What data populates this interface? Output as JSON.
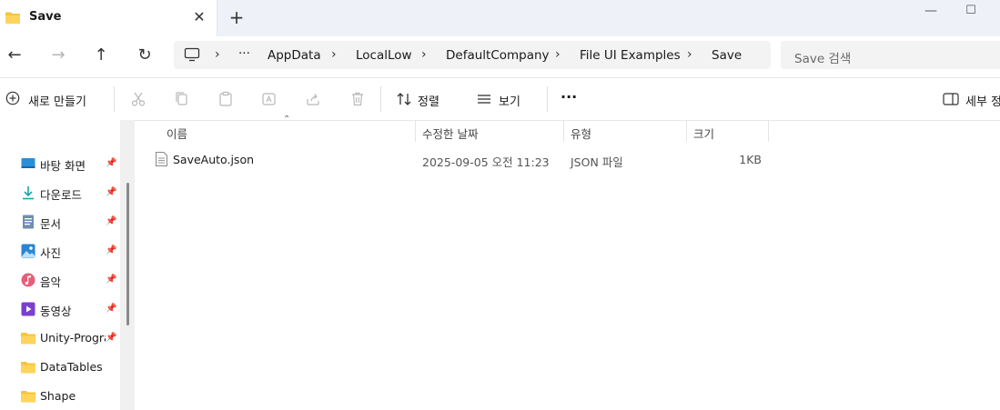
{
  "tab": {
    "title": "Save",
    "close": "✕"
  },
  "window": {
    "newtab": "+",
    "minimize": "—",
    "maximize": "☐"
  },
  "nav": {
    "back": "←",
    "forward": "→",
    "up": "↑",
    "refresh": "↻"
  },
  "address": {
    "ellipsis": "···",
    "sep": "›",
    "crumbs": [
      "AppData",
      "LocalLow",
      "DefaultCompany",
      "File UI Examples",
      "Save"
    ]
  },
  "search": {
    "placeholder": "Save 검색"
  },
  "commands": {
    "new": "새로 만들기",
    "sort": "정렬",
    "view": "보기",
    "more": "···",
    "details": "세부 정"
  },
  "sidebar": {
    "items": [
      {
        "label": "바탕 화면",
        "icon": "desktop-icon",
        "pinned": true
      },
      {
        "label": "다운로드",
        "icon": "download-icon",
        "pinned": true
      },
      {
        "label": "문서",
        "icon": "document-icon",
        "pinned": true
      },
      {
        "label": "사진",
        "icon": "pictures-icon",
        "pinned": true
      },
      {
        "label": "음악",
        "icon": "music-icon",
        "pinned": true
      },
      {
        "label": "동영상",
        "icon": "video-icon",
        "pinned": true
      },
      {
        "label": "Unity-Program",
        "icon": "folder-icon",
        "pinned": true
      },
      {
        "label": "DataTables",
        "icon": "folder-icon",
        "pinned": false
      },
      {
        "label": "Shape",
        "icon": "folder-icon",
        "pinned": false
      }
    ]
  },
  "columns": {
    "name": "이름",
    "modified": "수정한 날짜",
    "type": "유형",
    "size": "크기"
  },
  "files": [
    {
      "name": "SaveAuto.json",
      "modified": "2025-09-05 오전 11:23",
      "type": "JSON 파일",
      "size": "1KB"
    }
  ],
  "colors": {
    "accent": "#0067c0",
    "folder": "#f8c43c",
    "titlebar": "#eef2f8"
  }
}
